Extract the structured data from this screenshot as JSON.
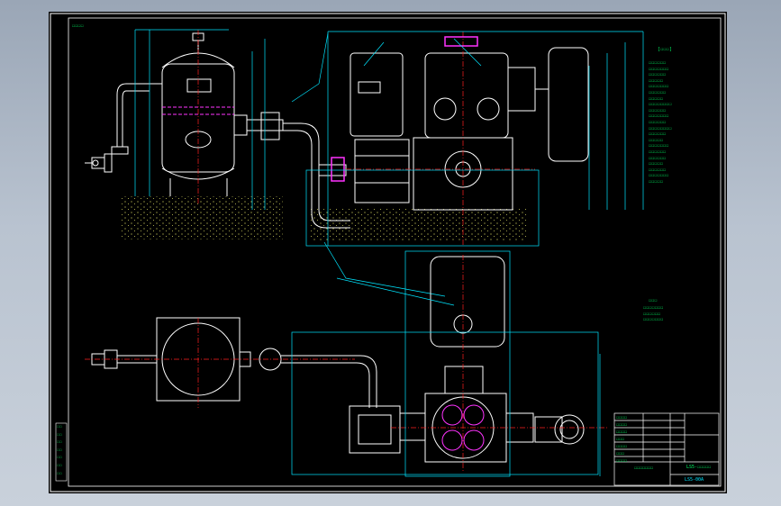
{
  "sheet": {
    "stamp": "☐☐☐☐",
    "notes_title": "[☐☐☐]",
    "notes_block_1": [
      "☐☐☐☐☐☐",
      "☐☐☐☐☐☐☐",
      "☐☐☐☐☐☐",
      "☐☐☐☐☐",
      "☐☐☐☐☐☐☐",
      "☐☐☐☐☐☐",
      "☐☐☐☐☐",
      "☐☐☐☐☐☐☐☐",
      "☐☐☐☐☐☐",
      "☐☐☐☐☐☐☐",
      "☐☐☐☐☐☐",
      "☐☐☐☐☐☐☐☐",
      "☐☐☐☐☐☐",
      "☐☐☐☐☐",
      "☐☐☐☐☐☐☐",
      "☐☐☐☐☐☐",
      "☐☐☐☐☐☐",
      "☐☐☐☐☐",
      "☐☐☐☐☐☐",
      "☐☐☐☐☐☐☐",
      "☐☐☐☐☐"
    ],
    "notes_mid_title": "☐☐☐",
    "notes_block_2": [
      "☐☐☐☐☐☐☐",
      "☐☐☐☐☐☐",
      "☐☐☐☐☐☐☐"
    ],
    "side_label": [
      "☐☐",
      "☐☐",
      "☐☐",
      "☐☐",
      "☐☐",
      "☐☐",
      "☐☐"
    ],
    "title_block": {
      "left_cells": [
        "☐☐☐☐",
        "☐☐☐☐",
        "☐☐☐☐",
        "☐☐☐",
        "☐☐☐☐",
        "☐☐☐",
        "☐☐☐☐"
      ],
      "middle_name": "☐☐☐☐☐☐☐",
      "ref_code": "LS5-☐☐☐☐☐",
      "drawing_number": "LS5-00A"
    }
  },
  "colors": {
    "background": "#000000",
    "line": "#ffffff",
    "dimension": "#00e5ff",
    "text": "#00ff66",
    "centerline": "#ff2020",
    "highlight": "#ff33ff",
    "ground": "#d8d860"
  },
  "icons": [
    "pump-icon",
    "tank-icon",
    "valve-icon",
    "motor-icon"
  ]
}
